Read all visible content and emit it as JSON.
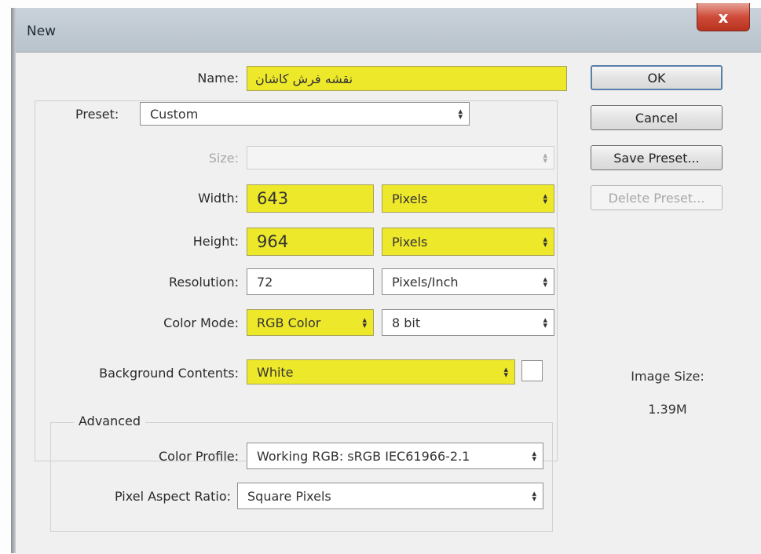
{
  "window": {
    "title": "New",
    "close_glyph": "x"
  },
  "buttons": {
    "ok": "OK",
    "cancel": "Cancel",
    "save_preset": "Save Preset...",
    "delete_preset": "Delete Preset..."
  },
  "name": {
    "label": "Name:",
    "value": "نقشه فرش کاشان"
  },
  "preset": {
    "label": "Preset:",
    "value": "Custom"
  },
  "size": {
    "label": "Size:",
    "value": ""
  },
  "width": {
    "label": "Width:",
    "value": "643",
    "unit": "Pixels"
  },
  "height": {
    "label": "Height:",
    "value": "964",
    "unit": "Pixels"
  },
  "resolution": {
    "label": "Resolution:",
    "value": "72",
    "unit": "Pixels/Inch"
  },
  "color_mode": {
    "label": "Color Mode:",
    "mode": "RGB Color",
    "depth": "8 bit"
  },
  "background": {
    "label": "Background Contents:",
    "value": "White",
    "swatch_color": "#ffffff"
  },
  "advanced": {
    "title": "Advanced",
    "color_profile_label": "Color Profile:",
    "color_profile": "Working RGB:  sRGB IEC61966-2.1",
    "pixel_aspect_label": "Pixel Aspect Ratio:",
    "pixel_aspect": "Square Pixels"
  },
  "image_size": {
    "label": "Image Size:",
    "value": "1.39M"
  },
  "icons": {
    "select_arrow": "up-down-arrows-icon",
    "close": "close-icon"
  },
  "colors": {
    "highlight": "#eee82b",
    "close_button": "#c8412f"
  }
}
